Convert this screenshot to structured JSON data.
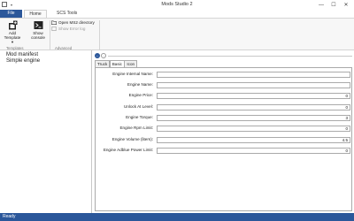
{
  "window": {
    "title": "Mods Studio 2",
    "controls": {
      "minimize": "—",
      "maximize": "☐",
      "close": "✕"
    }
  },
  "ribbon_tabs": {
    "file": "File",
    "home": "Home",
    "scs_tools": "SCS Tools"
  },
  "ribbon": {
    "add_template": "Add Template",
    "add_template_arrow": "▾",
    "show_console": "Show console",
    "open_ms2_directory": "Open MS2 directory",
    "show_error_log": "Show Error log",
    "group_templates": "Templates",
    "group_advanced": "Advanced"
  },
  "left_panel": {
    "items": [
      "Mod manifest",
      "Simple engine"
    ]
  },
  "nav": {
    "back": "←",
    "forward": "→"
  },
  "content_tabs": [
    "Truck",
    "Basic",
    "Icon"
  ],
  "active_tab": "Basic",
  "fields": [
    {
      "label": "Engine Internal Name:",
      "value": ""
    },
    {
      "label": "Engine Name:",
      "value": ""
    },
    {
      "label": "Engine Price:",
      "value": "0"
    },
    {
      "label": "Unlock At Level:",
      "value": "0"
    },
    {
      "label": "Engine Torque:",
      "value": "3"
    },
    {
      "label": "Engine Rpm Limit:",
      "value": "0"
    },
    {
      "label": "Engine Volume (liters):",
      "value": "4.5"
    },
    {
      "label": "Engine Adblue Power Limit:",
      "value": "0"
    }
  ],
  "status": {
    "text": "Ready"
  },
  "colors": {
    "accent": "#2b579a",
    "status_bar": "#2b579a"
  }
}
